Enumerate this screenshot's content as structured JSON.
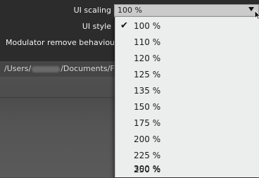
{
  "settings": {
    "ui_scaling_label": "UI scaling",
    "ui_style_label": "UI style",
    "modulator_label": "Modulator remove behaviour",
    "path_prefix": "/Users/",
    "path_suffix": "/Documents/FX"
  },
  "ui_scaling_select": {
    "value": "100 %"
  },
  "dropdown": {
    "selected_check": "✔",
    "options": [
      "100 %",
      "110 %",
      "120 %",
      "125 %",
      "135 %",
      "150 %",
      "175 %",
      "200 %",
      "225 %",
      "250 %",
      "300 %"
    ]
  }
}
